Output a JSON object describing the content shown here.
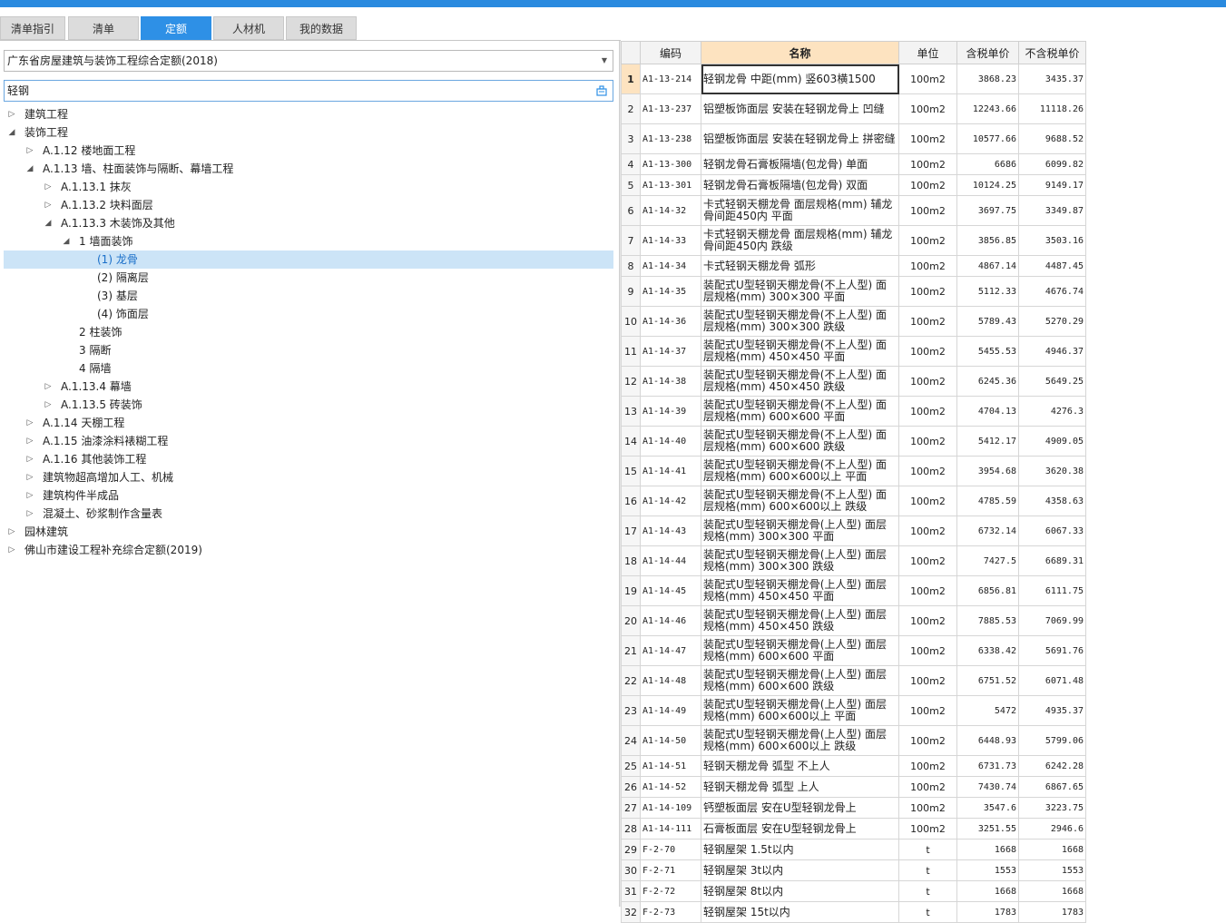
{
  "tabs": [
    {
      "label": "清单指引",
      "active": false
    },
    {
      "label": "清单",
      "active": false
    },
    {
      "label": "定额",
      "active": true
    },
    {
      "label": "人材机",
      "active": false
    },
    {
      "label": "我的数据",
      "active": false
    }
  ],
  "dropdown": {
    "value": "广东省房屋建筑与装饰工程综合定额(2018)"
  },
  "search": {
    "value": "轻钢"
  },
  "tree": [
    {
      "label": "建筑工程",
      "level": 0,
      "state": "collapsed"
    },
    {
      "label": "装饰工程",
      "level": 0,
      "state": "expanded"
    },
    {
      "label": "A.1.12 楼地面工程",
      "level": 1,
      "state": "collapsed"
    },
    {
      "label": "A.1.13 墙、柱面装饰与隔断、幕墙工程",
      "level": 1,
      "state": "expanded"
    },
    {
      "label": "A.1.13.1 抹灰",
      "level": 2,
      "state": "collapsed"
    },
    {
      "label": "A.1.13.2 块料面层",
      "level": 2,
      "state": "collapsed"
    },
    {
      "label": "A.1.13.3 木装饰及其他",
      "level": 2,
      "state": "expanded"
    },
    {
      "label": "1 墙面装饰",
      "level": 3,
      "state": "expanded"
    },
    {
      "label": "(1) 龙骨",
      "level": 4,
      "state": "leaf",
      "selected": true
    },
    {
      "label": "(2) 隔离层",
      "level": 4,
      "state": "leaf"
    },
    {
      "label": "(3) 基层",
      "level": 4,
      "state": "leaf"
    },
    {
      "label": "(4) 饰面层",
      "level": 4,
      "state": "leaf"
    },
    {
      "label": "2 柱装饰",
      "level": 3,
      "state": "leaf"
    },
    {
      "label": "3 隔断",
      "level": 3,
      "state": "leaf"
    },
    {
      "label": "4 隔墙",
      "level": 3,
      "state": "leaf"
    },
    {
      "label": "A.1.13.4 幕墙",
      "level": 2,
      "state": "collapsed"
    },
    {
      "label": "A.1.13.5 砖装饰",
      "level": 2,
      "state": "collapsed"
    },
    {
      "label": "A.1.14 天棚工程",
      "level": 1,
      "state": "collapsed"
    },
    {
      "label": "A.1.15 油漆涂料裱糊工程",
      "level": 1,
      "state": "collapsed"
    },
    {
      "label": "A.1.16 其他装饰工程",
      "level": 1,
      "state": "collapsed"
    },
    {
      "label": "建筑物超高增加人工、机械",
      "level": 1,
      "state": "collapsed"
    },
    {
      "label": "建筑构件半成品",
      "level": 1,
      "state": "collapsed"
    },
    {
      "label": "混凝土、砂浆制作含量表",
      "level": 1,
      "state": "collapsed"
    },
    {
      "label": "园林建筑",
      "level": 0,
      "state": "collapsed"
    },
    {
      "label": "佛山市建设工程补充综合定额(2019)",
      "level": 0,
      "state": "collapsed"
    }
  ],
  "table": {
    "headers": [
      "",
      "编码",
      "名称",
      "单位",
      "含税单价",
      "不含税单价"
    ],
    "rows": [
      {
        "n": "1",
        "code": "A1-13-214",
        "name": "轻钢龙骨 中距(mm) 竖603横1500",
        "unit": "100m2",
        "tax": "3868.23",
        "notax": "3435.37"
      },
      {
        "n": "2",
        "code": "A1-13-237",
        "name": "铝塑板饰面层 安装在轻钢龙骨上 凹缝",
        "unit": "100m2",
        "tax": "12243.66",
        "notax": "11118.26"
      },
      {
        "n": "3",
        "code": "A1-13-238",
        "name": "铝塑板饰面层 安装在轻钢龙骨上 拼密缝",
        "unit": "100m2",
        "tax": "10577.66",
        "notax": "9688.52"
      },
      {
        "n": "4",
        "code": "A1-13-300",
        "name": "轻钢龙骨石膏板隔墙(包龙骨) 单面",
        "unit": "100m2",
        "tax": "6686",
        "notax": "6099.82"
      },
      {
        "n": "5",
        "code": "A1-13-301",
        "name": "轻钢龙骨石膏板隔墙(包龙骨) 双面",
        "unit": "100m2",
        "tax": "10124.25",
        "notax": "9149.17"
      },
      {
        "n": "6",
        "code": "A1-14-32",
        "name": "卡式轻钢天棚龙骨 面层规格(mm) 辅龙骨间距450内 平面",
        "unit": "100m2",
        "tax": "3697.75",
        "notax": "3349.87"
      },
      {
        "n": "7",
        "code": "A1-14-33",
        "name": "卡式轻钢天棚龙骨 面层规格(mm) 辅龙骨间距450内 跌级",
        "unit": "100m2",
        "tax": "3856.85",
        "notax": "3503.16"
      },
      {
        "n": "8",
        "code": "A1-14-34",
        "name": "卡式轻钢天棚龙骨 弧形",
        "unit": "100m2",
        "tax": "4867.14",
        "notax": "4487.45"
      },
      {
        "n": "9",
        "code": "A1-14-35",
        "name": "装配式U型轻钢天棚龙骨(不上人型) 面层规格(mm) 300×300 平面",
        "unit": "100m2",
        "tax": "5112.33",
        "notax": "4676.74"
      },
      {
        "n": "10",
        "code": "A1-14-36",
        "name": "装配式U型轻钢天棚龙骨(不上人型) 面层规格(mm) 300×300 跌级",
        "unit": "100m2",
        "tax": "5789.43",
        "notax": "5270.29"
      },
      {
        "n": "11",
        "code": "A1-14-37",
        "name": "装配式U型轻钢天棚龙骨(不上人型) 面层规格(mm) 450×450 平面",
        "unit": "100m2",
        "tax": "5455.53",
        "notax": "4946.37"
      },
      {
        "n": "12",
        "code": "A1-14-38",
        "name": "装配式U型轻钢天棚龙骨(不上人型) 面层规格(mm) 450×450 跌级",
        "unit": "100m2",
        "tax": "6245.36",
        "notax": "5649.25"
      },
      {
        "n": "13",
        "code": "A1-14-39",
        "name": "装配式U型轻钢天棚龙骨(不上人型) 面层规格(mm) 600×600 平面",
        "unit": "100m2",
        "tax": "4704.13",
        "notax": "4276.3"
      },
      {
        "n": "14",
        "code": "A1-14-40",
        "name": "装配式U型轻钢天棚龙骨(不上人型) 面层规格(mm) 600×600 跌级",
        "unit": "100m2",
        "tax": "5412.17",
        "notax": "4909.05"
      },
      {
        "n": "15",
        "code": "A1-14-41",
        "name": "装配式U型轻钢天棚龙骨(不上人型) 面层规格(mm) 600×600以上 平面",
        "unit": "100m2",
        "tax": "3954.68",
        "notax": "3620.38"
      },
      {
        "n": "16",
        "code": "A1-14-42",
        "name": "装配式U型轻钢天棚龙骨(不上人型) 面层规格(mm) 600×600以上 跌级",
        "unit": "100m2",
        "tax": "4785.59",
        "notax": "4358.63"
      },
      {
        "n": "17",
        "code": "A1-14-43",
        "name": "装配式U型轻钢天棚龙骨(上人型) 面层规格(mm) 300×300 平面",
        "unit": "100m2",
        "tax": "6732.14",
        "notax": "6067.33"
      },
      {
        "n": "18",
        "code": "A1-14-44",
        "name": "装配式U型轻钢天棚龙骨(上人型) 面层规格(mm) 300×300 跌级",
        "unit": "100m2",
        "tax": "7427.5",
        "notax": "6689.31"
      },
      {
        "n": "19",
        "code": "A1-14-45",
        "name": "装配式U型轻钢天棚龙骨(上人型) 面层规格(mm) 450×450 平面",
        "unit": "100m2",
        "tax": "6856.81",
        "notax": "6111.75"
      },
      {
        "n": "20",
        "code": "A1-14-46",
        "name": "装配式U型轻钢天棚龙骨(上人型) 面层规格(mm) 450×450 跌级",
        "unit": "100m2",
        "tax": "7885.53",
        "notax": "7069.99"
      },
      {
        "n": "21",
        "code": "A1-14-47",
        "name": "装配式U型轻钢天棚龙骨(上人型) 面层规格(mm) 600×600 平面",
        "unit": "100m2",
        "tax": "6338.42",
        "notax": "5691.76"
      },
      {
        "n": "22",
        "code": "A1-14-48",
        "name": "装配式U型轻钢天棚龙骨(上人型) 面层规格(mm) 600×600 跌级",
        "unit": "100m2",
        "tax": "6751.52",
        "notax": "6071.48"
      },
      {
        "n": "23",
        "code": "A1-14-49",
        "name": "装配式U型轻钢天棚龙骨(上人型) 面层规格(mm) 600×600以上 平面",
        "unit": "100m2",
        "tax": "5472",
        "notax": "4935.37"
      },
      {
        "n": "24",
        "code": "A1-14-50",
        "name": "装配式U型轻钢天棚龙骨(上人型) 面层规格(mm) 600×600以上 跌级",
        "unit": "100m2",
        "tax": "6448.93",
        "notax": "5799.06"
      },
      {
        "n": "25",
        "code": "A1-14-51",
        "name": "轻钢天棚龙骨 弧型 不上人",
        "unit": "100m2",
        "tax": "6731.73",
        "notax": "6242.28"
      },
      {
        "n": "26",
        "code": "A1-14-52",
        "name": "轻钢天棚龙骨 弧型 上人",
        "unit": "100m2",
        "tax": "7430.74",
        "notax": "6867.65"
      },
      {
        "n": "27",
        "code": "A1-14-109",
        "name": "钙塑板面层 安在U型轻钢龙骨上",
        "unit": "100m2",
        "tax": "3547.6",
        "notax": "3223.75"
      },
      {
        "n": "28",
        "code": "A1-14-111",
        "name": "石膏板面层 安在U型轻钢龙骨上",
        "unit": "100m2",
        "tax": "3251.55",
        "notax": "2946.6"
      },
      {
        "n": "29",
        "code": "F-2-70",
        "name": "轻钢屋架 1.5t以内",
        "unit": "t",
        "tax": "1668",
        "notax": "1668"
      },
      {
        "n": "30",
        "code": "F-2-71",
        "name": "轻钢屋架 3t以内",
        "unit": "t",
        "tax": "1553",
        "notax": "1553"
      },
      {
        "n": "31",
        "code": "F-2-72",
        "name": "轻钢屋架 8t以内",
        "unit": "t",
        "tax": "1668",
        "notax": "1668"
      },
      {
        "n": "32",
        "code": "F-2-73",
        "name": "轻钢屋架 15t以内",
        "unit": "t",
        "tax": "1783",
        "notax": "1783"
      }
    ]
  }
}
